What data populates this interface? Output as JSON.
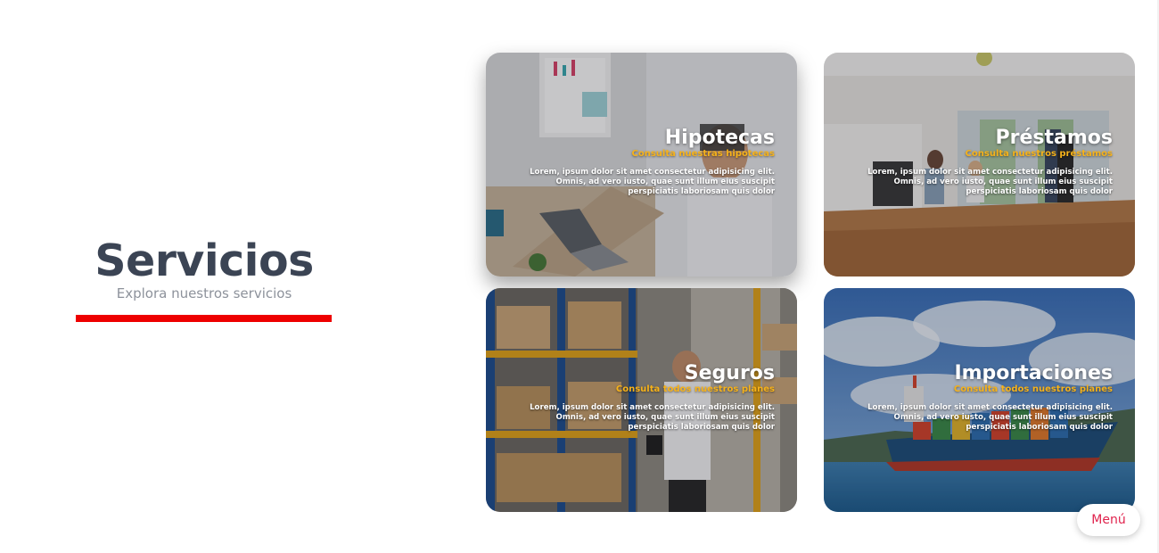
{
  "hero": {
    "title": "Servicios",
    "subtitle": "Explora nuestros servicios"
  },
  "cards": [
    {
      "title": "Hipotecas",
      "subtitle": "Consulta nuestras hipotecas",
      "description": "Lorem, ipsum dolor sit amet consectetur adipisicing elit. Omnis, ad vero iusto, quae sunt illum eius suscipit perspiciatis laboriosam quis dolor"
    },
    {
      "title": "Préstamos",
      "subtitle": "Consulta nuestros préstamos",
      "description": "Lorem, ipsum dolor sit amet consectetur adipisicing elit. Omnis, ad vero iusto, quae sunt illum eius suscipit perspiciatis laboriosam quis dolor"
    },
    {
      "title": "Seguros",
      "subtitle": "Consulta todos nuestros planes",
      "description": "Lorem, ipsum dolor sit amet consectetur adipisicing elit. Omnis, ad vero iusto, quae sunt illum eius suscipit perspiciatis laboriosam quis dolor"
    },
    {
      "title": "Importaciones",
      "subtitle": "Consulta todos nuestros planes",
      "description": "Lorem, ipsum dolor sit amet consectetur adipisicing elit. Omnis, ad vero iusto, quae sunt illum eius suscipit perspiciatis laboriosam quis dolor"
    }
  ],
  "menu": {
    "label": "Menú"
  },
  "colors": {
    "accent_bar": "#ee0000",
    "subtitle_gold": "#f6b21a",
    "menu_text": "#e0244e",
    "title_text": "#3b4454"
  }
}
